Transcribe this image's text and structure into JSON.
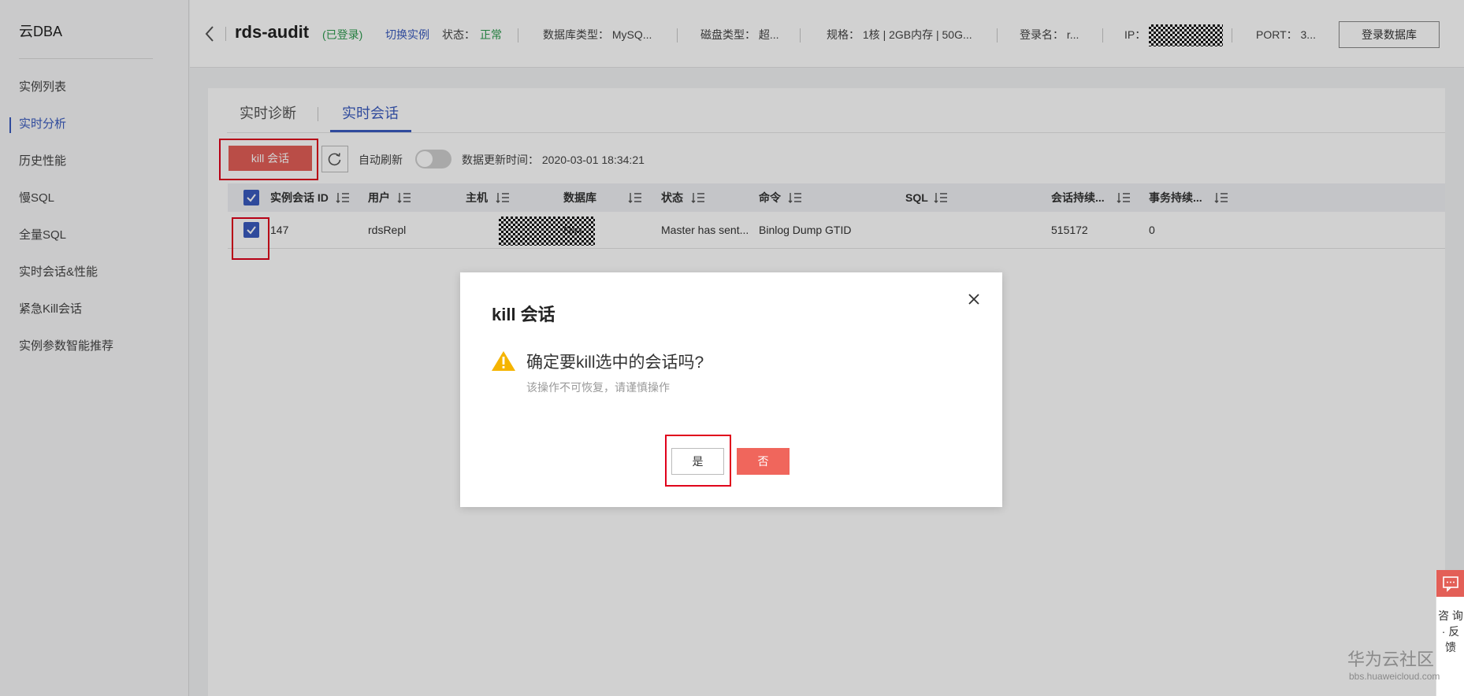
{
  "sidebar": {
    "brand": "云DBA",
    "items": [
      {
        "label": "实例列表",
        "active": false
      },
      {
        "label": "实时分析",
        "active": true
      },
      {
        "label": "历史性能",
        "active": false
      },
      {
        "label": "慢SQL",
        "active": false
      },
      {
        "label": "全量SQL",
        "active": false
      },
      {
        "label": "实时会话&性能",
        "active": false
      },
      {
        "label": "紧急Kill会话",
        "active": false
      },
      {
        "label": "实例参数智能推荐",
        "active": false
      }
    ]
  },
  "header": {
    "title": "rds-audit",
    "login_state": "(已登录)",
    "switch_instance": "切换实例",
    "status_label": "状态：",
    "status_value": "正常",
    "db_type": "数据库类型：  MySQ...",
    "disk_type": "磁盘类型：  超...",
    "spec": "规格：  1核 | 2GB内存 | 50G...",
    "login_name": "登录名：  r...",
    "ip_label": "IP：",
    "port": "PORT：  3...",
    "login_db_button": "登录数据库"
  },
  "tabs": [
    {
      "label": "实时诊断",
      "active": false
    },
    {
      "label": "实时会话",
      "active": true
    }
  ],
  "toolbar": {
    "kill_button": "kill 会话",
    "auto_refresh_label": "自动刷新",
    "auto_refresh_on": false,
    "update_time": "数据更新时间：  2020-03-01 18:34:21"
  },
  "table": {
    "columns": [
      "实例会话 ID",
      "用户",
      "主机",
      "数据库",
      "状态",
      "命令",
      "SQL",
      "会话持续...",
      "事务持续..."
    ],
    "rows": [
      {
        "checked": true,
        "id": "147",
        "user": "rdsRepl",
        "host": "",
        "db": "N/A",
        "state": "Master has sent...",
        "command": "Binlog Dump GTID",
        "sql": "",
        "session_duration": "515172",
        "txn_duration": "0"
      }
    ]
  },
  "dialog": {
    "title": "kill 会话",
    "message": "确定要kill选中的会话吗?",
    "submessage": "该操作不可恢复，请谨慎操作",
    "yes": "是",
    "no": "否"
  },
  "consult": {
    "text": "咨 询 · 反 馈"
  },
  "watermark": {
    "name": "华为云社区",
    "url": "bbs.huaweicloud.com"
  },
  "colors": {
    "accent": "#3a5bbf",
    "danger": "#e35f57",
    "success": "#2c9a4e",
    "highlight": "#e0001b"
  }
}
